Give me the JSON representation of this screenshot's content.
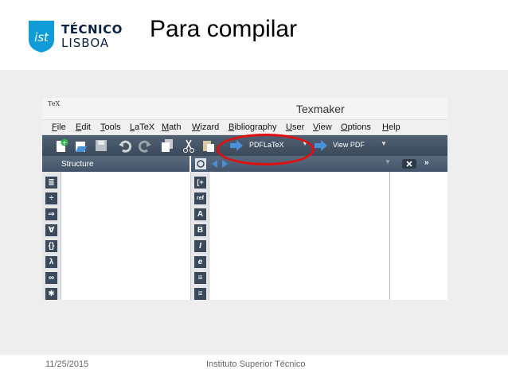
{
  "slide": {
    "title": "Para compilar",
    "logo_line1": "TÉCNICO",
    "logo_line2": "LISBOA",
    "footer_date": "11/25/2015",
    "footer_institution": "Instituto Superior Técnico"
  },
  "window": {
    "app_icon_text": "TeX",
    "title": "Texmaker",
    "menu": [
      {
        "u": "F",
        "rest": "ile"
      },
      {
        "u": "E",
        "rest": "dit"
      },
      {
        "u": "T",
        "rest": "ools"
      },
      {
        "u": "L",
        "rest": "aTeX"
      },
      {
        "u": "M",
        "rest": "ath"
      },
      {
        "u": "W",
        "rest": "izard"
      },
      {
        "u": "B",
        "rest": "ibliography"
      },
      {
        "u": "U",
        "rest": "ser"
      },
      {
        "u": "V",
        "rest": "iew"
      },
      {
        "u": "O",
        "rest": "ptions"
      },
      {
        "u": "H",
        "rest": "elp"
      }
    ],
    "compile_command": "PDFLaTeX",
    "view_command": "View PDF",
    "structure_label": "Structure",
    "left_symbols": [
      "≣",
      "÷",
      "⇒",
      "∀",
      "{}",
      "λ",
      "∞",
      "✱"
    ],
    "mid_symbols": [
      "[+",
      "ref",
      "A",
      "B",
      "I",
      "e",
      "≡",
      "≡"
    ]
  },
  "colors": {
    "toolbar": "#3b4a5a",
    "highlight": "#e01010",
    "slide_body": "#eeeeee",
    "brand": "#0b2340"
  }
}
